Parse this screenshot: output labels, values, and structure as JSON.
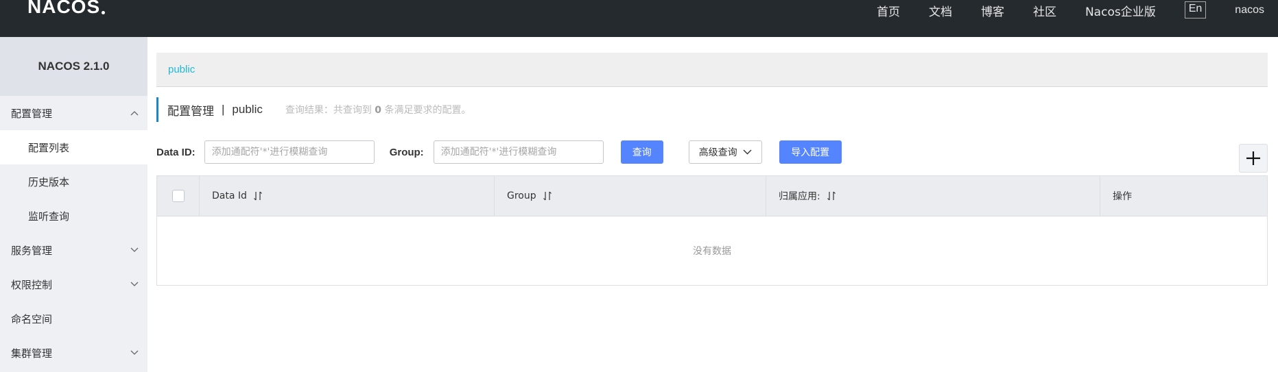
{
  "header": {
    "logo": "NACOS",
    "nav": [
      "首页",
      "文档",
      "博客",
      "社区",
      "Nacos企业版"
    ],
    "lang": "En",
    "user": "nacos"
  },
  "sidebar": {
    "version": "NACOS 2.1.0",
    "groups": [
      {
        "label": "配置管理",
        "expanded": true,
        "items": [
          "配置列表",
          "历史版本",
          "监听查询"
        ]
      },
      {
        "label": "服务管理",
        "expanded": false
      },
      {
        "label": "权限控制",
        "expanded": false
      },
      {
        "label": "命名空间"
      },
      {
        "label": "集群管理",
        "expanded": false
      }
    ]
  },
  "main": {
    "namespace_link": "public",
    "title": "配置管理",
    "title_sep": "|",
    "title_ns": "public",
    "result_prefix": "查询结果：共查询到",
    "result_count": "0",
    "result_suffix": "条满足要求的配置。",
    "filter": {
      "data_id_label": "Data ID:",
      "data_id_placeholder": "添加通配符'*'进行模糊查询",
      "group_label": "Group:",
      "group_placeholder": "添加通配符'*'进行模糊查询",
      "search_label": "查询",
      "advanced_label": "高级查询",
      "import_label": "导入配置"
    },
    "table": {
      "columns": [
        "Data Id",
        "Group",
        "归属应用:",
        "操作"
      ],
      "empty_text": "没有数据"
    }
  },
  "colors": {
    "header_bg": "#252a2f",
    "sidebar_bg": "#eef0f4",
    "primary": "#5584ff",
    "link": "#21b8d6",
    "title_accent": "#1f84c6"
  }
}
